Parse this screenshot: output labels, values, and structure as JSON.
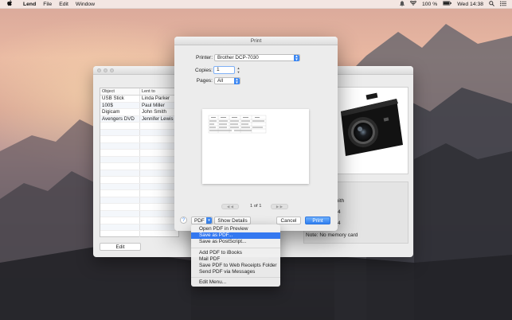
{
  "menubar": {
    "app_name": "Lend",
    "items": [
      "File",
      "Edit",
      "Window"
    ],
    "battery": "100 %",
    "clock": "Wed 14:38"
  },
  "lend_window": {
    "columns": [
      "Object",
      "Lent to"
    ],
    "rows": [
      {
        "object": "USB Stick",
        "lent_to": "Linda Parker"
      },
      {
        "object": "100$",
        "lent_to": "Paul Miller"
      },
      {
        "object": "Digicam",
        "lent_to": "John Smith"
      },
      {
        "object": "Avengers DVD",
        "lent_to": "Jennifer Lewis"
      }
    ],
    "edit_label": "Edit",
    "info_partial": [
      "n",
      "mith",
      "4",
      "4"
    ],
    "note": "Note: No memory card"
  },
  "print_dialog": {
    "title": "Print",
    "printer_label": "Printer:",
    "printer_value": "Brother DCP-7030",
    "copies_label": "Copies:",
    "copies_value": "1",
    "pages_label": "Pages:",
    "pages_value": "All",
    "page_counter": "1 of 1",
    "help_label": "?",
    "pdf_label": "PDF",
    "show_details_label": "Show Details",
    "cancel_label": "Cancel",
    "print_label": "Print"
  },
  "pdf_menu": {
    "group1": [
      "Open PDF in Preview",
      "Save as PDF...",
      "Save as PostScript..."
    ],
    "selected": "Save as PDF...",
    "group2": [
      "Add PDF to iBooks",
      "Mail PDF",
      "Save PDF to Web Receipts Folder",
      "Send PDF via Messages"
    ],
    "group3": [
      "Edit Menu..."
    ]
  },
  "colors": {
    "accent": "#3478f0",
    "window_bg": "#ececec"
  }
}
